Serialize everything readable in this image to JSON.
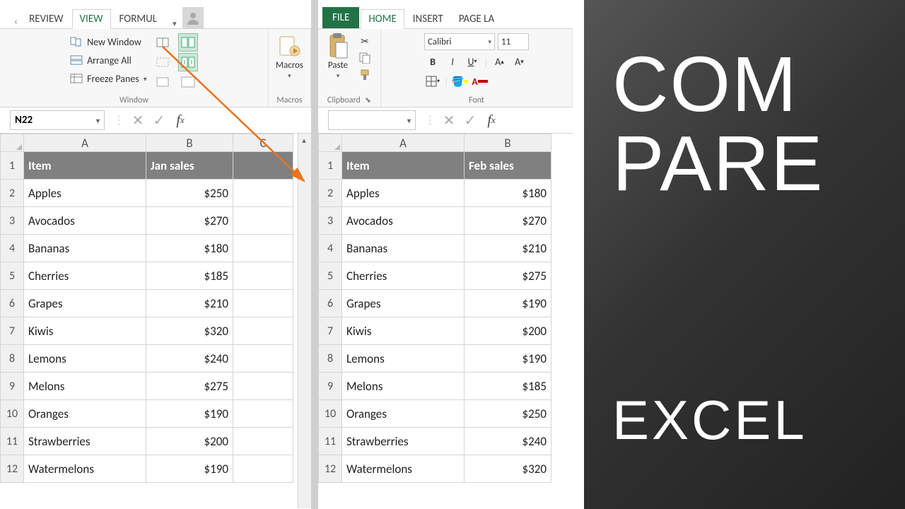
{
  "left": {
    "tabs": [
      "REVIEW",
      "VIEW",
      "FORMUL"
    ],
    "active_tab": 1,
    "window_group": {
      "label": "Window",
      "items": [
        "New Window",
        "Arrange All",
        "Freeze Panes"
      ]
    },
    "macros_group": {
      "label": "Macros",
      "button": "Macros"
    },
    "namebox": "N22",
    "columns": [
      "A",
      "B",
      "C"
    ],
    "header": {
      "item": "Item",
      "sales": "Jan sales"
    },
    "rows": [
      {
        "n": 1
      },
      {
        "n": 2,
        "item": "Apples",
        "sales": "$250"
      },
      {
        "n": 3,
        "item": "Avocados",
        "sales": "$270"
      },
      {
        "n": 4,
        "item": "Bananas",
        "sales": "$180"
      },
      {
        "n": 5,
        "item": "Cherries",
        "sales": "$185"
      },
      {
        "n": 6,
        "item": "Grapes",
        "sales": "$210"
      },
      {
        "n": 7,
        "item": "Kiwis",
        "sales": "$320"
      },
      {
        "n": 8,
        "item": "Lemons",
        "sales": "$240"
      },
      {
        "n": 9,
        "item": "Melons",
        "sales": "$275"
      },
      {
        "n": 10,
        "item": "Oranges",
        "sales": "$190"
      },
      {
        "n": 11,
        "item": "Strawberries",
        "sales": "$200"
      },
      {
        "n": 12,
        "item": "Watermelons",
        "sales": "$190"
      }
    ]
  },
  "right": {
    "tabs": [
      "FILE",
      "HOME",
      "INSERT",
      "PAGE LA"
    ],
    "active_tab": 1,
    "clipboard_label": "Clipboard",
    "paste_label": "Paste",
    "font_label": "Font",
    "font_name": "Calibri",
    "font_size": "11",
    "columns": [
      "A",
      "B"
    ],
    "header": {
      "item": "Item",
      "sales": "Feb sales"
    },
    "rows": [
      {
        "n": 1
      },
      {
        "n": 2,
        "item": "Apples",
        "sales": "$180"
      },
      {
        "n": 3,
        "item": "Avocados",
        "sales": "$270"
      },
      {
        "n": 4,
        "item": "Bananas",
        "sales": "$210"
      },
      {
        "n": 5,
        "item": "Cherries",
        "sales": "$275"
      },
      {
        "n": 6,
        "item": "Grapes",
        "sales": "$190"
      },
      {
        "n": 7,
        "item": "Kiwis",
        "sales": "$200"
      },
      {
        "n": 8,
        "item": "Lemons",
        "sales": "$190"
      },
      {
        "n": 9,
        "item": "Melons",
        "sales": "$185"
      },
      {
        "n": 10,
        "item": "Oranges",
        "sales": "$250"
      },
      {
        "n": 11,
        "item": "Strawberries",
        "sales": "$240"
      },
      {
        "n": 12,
        "item": "Watermelons",
        "sales": "$320"
      }
    ]
  },
  "overlay": {
    "line1": "COM",
    "line2": "PARE",
    "line3": "EXCEL"
  },
  "chart_data": {
    "type": "table",
    "tables": [
      {
        "title": "Jan sales",
        "columns": [
          "Item",
          "Jan sales"
        ],
        "rows": [
          [
            "Apples",
            250
          ],
          [
            "Avocados",
            270
          ],
          [
            "Bananas",
            180
          ],
          [
            "Cherries",
            185
          ],
          [
            "Grapes",
            210
          ],
          [
            "Kiwis",
            320
          ],
          [
            "Lemons",
            240
          ],
          [
            "Melons",
            275
          ],
          [
            "Oranges",
            190
          ],
          [
            "Strawberries",
            200
          ],
          [
            "Watermelons",
            190
          ]
        ]
      },
      {
        "title": "Feb sales",
        "columns": [
          "Item",
          "Feb sales"
        ],
        "rows": [
          [
            "Apples",
            180
          ],
          [
            "Avocados",
            270
          ],
          [
            "Bananas",
            210
          ],
          [
            "Cherries",
            275
          ],
          [
            "Grapes",
            190
          ],
          [
            "Kiwis",
            200
          ],
          [
            "Lemons",
            190
          ],
          [
            "Melons",
            185
          ],
          [
            "Oranges",
            250
          ],
          [
            "Strawberries",
            240
          ],
          [
            "Watermelons",
            320
          ]
        ]
      }
    ]
  }
}
